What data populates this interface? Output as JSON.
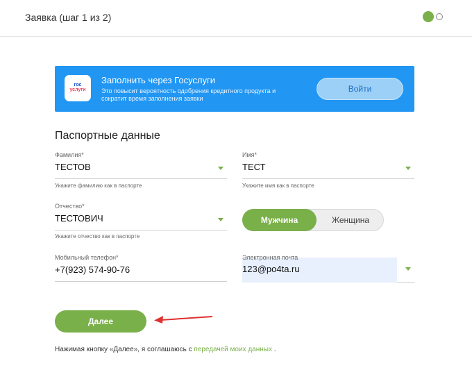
{
  "header": {
    "title": "Заявка (шаг 1 из 2)",
    "steps": {
      "current": 1,
      "total": 2
    }
  },
  "gosuslugi": {
    "logo_line1": "гос",
    "logo_line2": "услуги",
    "title": "Заполнить через Госуслуги",
    "description": "Это повысит вероятность одобрения кредитного продукта и сократит время заполнения заявки",
    "button_label": "Войти"
  },
  "section_title": "Паспортные данные",
  "fields": {
    "last_name": {
      "label": "Фамилия*",
      "value": "ТЕСТОВ",
      "hint": "Укажите фамилию как в паспорте"
    },
    "first_name": {
      "label": "Имя*",
      "value": "ТЕСТ",
      "hint": "Укажите имя как в паспорте"
    },
    "patronymic": {
      "label": "Отчество*",
      "value": "ТЕСТОВИЧ",
      "hint": "Укажите отчество как в паспорте"
    },
    "phone": {
      "label": "Мобильный телефон*",
      "value": "+7(923) 574-90-76"
    },
    "email": {
      "label": "Электронная почта",
      "value": "123@po4ta.ru"
    }
  },
  "gender": {
    "male": "Мужчина",
    "female": "Женщина",
    "selected": "male"
  },
  "next_button": "Далее",
  "consent": {
    "prefix": "Нажимая кнопку «Далее», я соглашаюсь с ",
    "link": "передачей моих данных",
    "suffix": " ."
  },
  "colors": {
    "accent_green": "#7ab04a",
    "gosuslugi_blue": "#2196f3",
    "annotation_arrow": "#e03030"
  }
}
